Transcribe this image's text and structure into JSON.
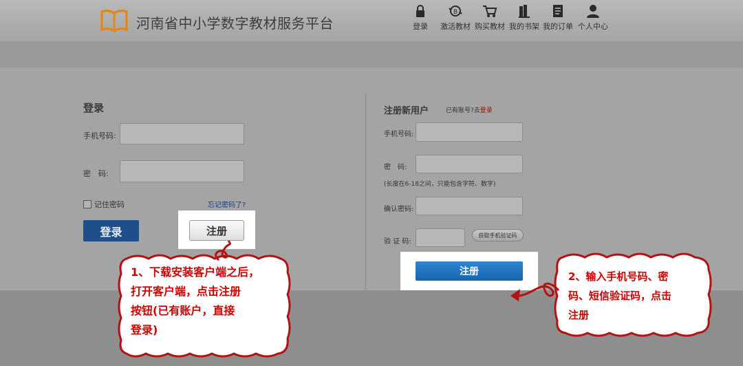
{
  "header": {
    "site_title": "河南省中小学数字教材服务平台",
    "nav": [
      {
        "label": "登录",
        "icon": "lock-icon"
      },
      {
        "label": "激活教材",
        "icon": "activate-icon"
      },
      {
        "label": "购买教材",
        "icon": "cart-icon"
      },
      {
        "label": "我的书架",
        "icon": "bookshelf-icon"
      },
      {
        "label": "我的订单",
        "icon": "order-icon"
      },
      {
        "label": "个人中心",
        "icon": "user-icon"
      }
    ]
  },
  "login": {
    "title": "登录",
    "phone_label": "手机号码:",
    "phone_value": "",
    "password_label": "密　码:",
    "password_value": "",
    "remember_label": "记住密码",
    "forgot_label": "忘记密码了?",
    "login_button": "登录",
    "register_button": "注册"
  },
  "register": {
    "title": "注册新用户",
    "have_account_text": "已有账号?去",
    "have_account_link": "登录",
    "phone_label": "手机号码:",
    "phone_value": "",
    "password_label": "密　码:",
    "password_value": "",
    "password_hint": "(长度在6-18之间，只能包含字符、数字)",
    "confirm_label": "确认密码:",
    "confirm_value": "",
    "code_label": "验 证 码:",
    "code_value": "",
    "sms_button": "获取手机验证码",
    "register_button": "注册"
  },
  "annotations": {
    "note1_lines": [
      "1、下载安装客户端之后，",
      "打开客户端，点击注册",
      "按钮(已有账户，直接",
      "登录)"
    ],
    "note2_lines": [
      "2、输入手机号码、密",
      "码、短信验证码，点击",
      "注册"
    ]
  },
  "colors": {
    "accent_blue": "#1f4f8a",
    "register_blue": "#1f74c0",
    "callout_red": "#cc0000",
    "logo_orange": "#e0891f"
  }
}
